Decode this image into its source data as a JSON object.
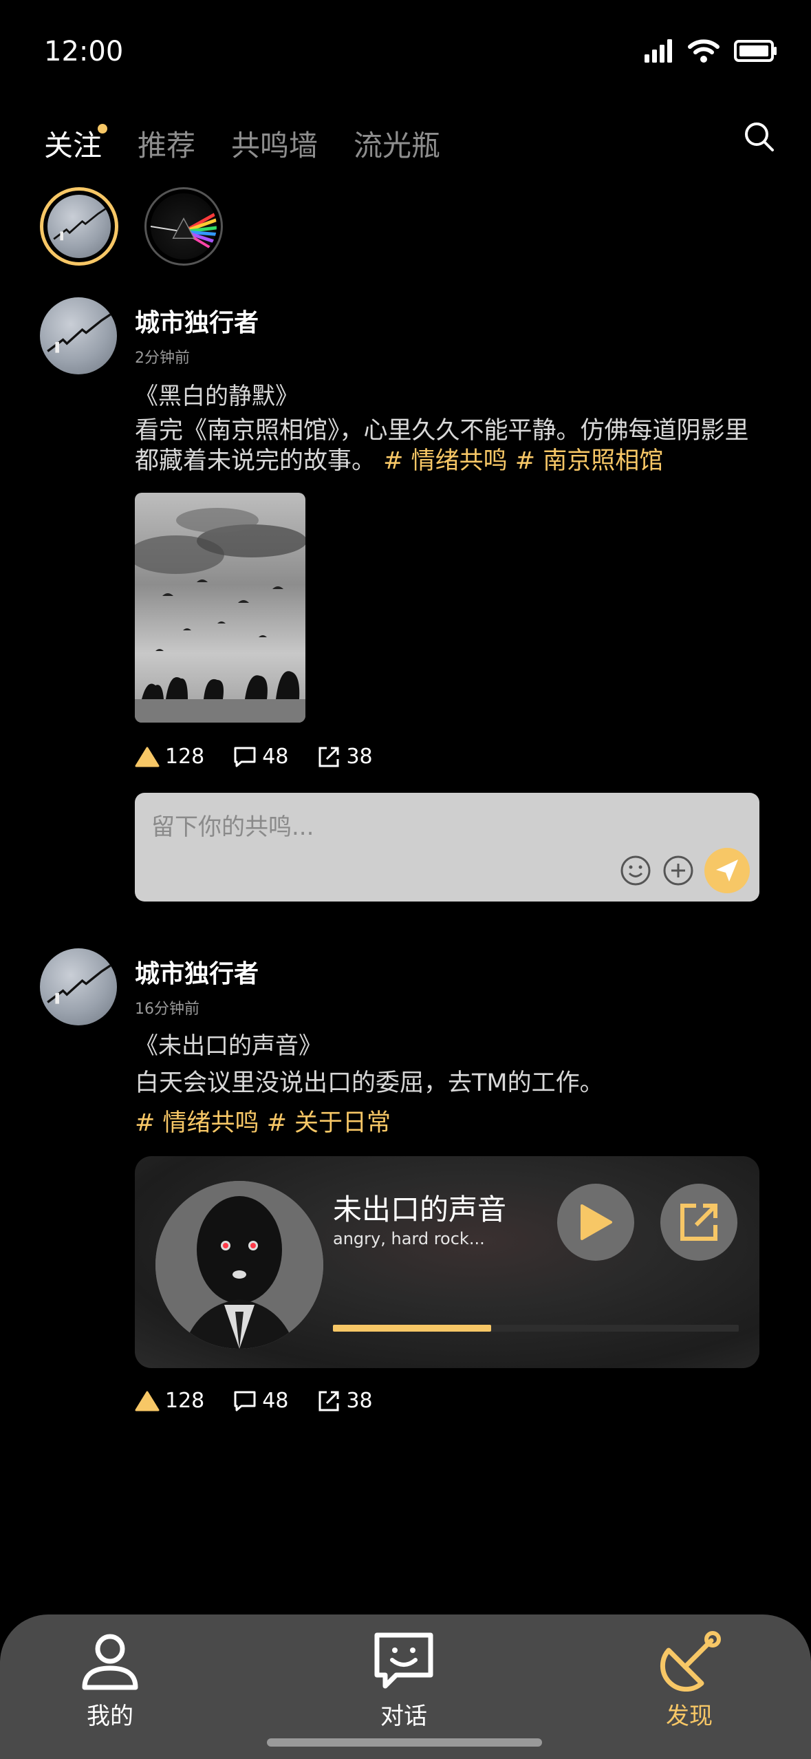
{
  "status_bar": {
    "time": "12:00"
  },
  "tabs": [
    {
      "label": "关注",
      "active": true,
      "has_dot": true
    },
    {
      "label": "推荐"
    },
    {
      "label": "共鸣墙"
    },
    {
      "label": "流光瓶"
    }
  ],
  "posts": [
    {
      "author": "城市独行者",
      "time": "2分钟前",
      "title": "《黑白的静默》",
      "body": "看完《南京照相馆》，心里久久不能平静。仿佛每道阴影里都藏着未说完的故事。",
      "tags": [
        "# 情绪共鸣",
        "# 南京照相馆"
      ],
      "likes": "128",
      "comments": "48",
      "shares": "38",
      "comment_placeholder": "留下你的共鸣..."
    },
    {
      "author": "城市独行者",
      "time": "16分钟前",
      "title": "《未出口的声音》",
      "body": "白天会议里没说出口的委屈，去TM的工作。",
      "tags": [
        "# 情绪共鸣",
        "# 关于日常"
      ],
      "music": {
        "title": "未出口的声音",
        "subtitle": "angry, hard rock...",
        "progress": 0.39
      },
      "likes": "128",
      "comments": "48",
      "shares": "38"
    }
  ],
  "bottom_nav": [
    {
      "label": "我的",
      "icon": "person-icon"
    },
    {
      "label": "对话",
      "icon": "chat-icon"
    },
    {
      "label": "发现",
      "icon": "discover-icon",
      "active": true
    }
  ],
  "colors": {
    "accent": "#f7c766",
    "background": "#000000",
    "nav_bg": "#4a4a4a"
  }
}
